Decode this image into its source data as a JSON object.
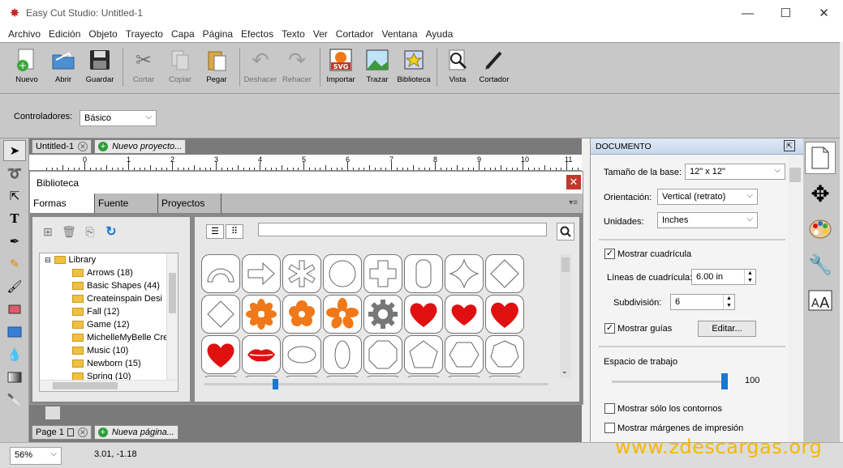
{
  "window": {
    "title": "Easy Cut Studio: Untitled-1"
  },
  "menu": [
    "Archivo",
    "Edición",
    "Objeto",
    "Trayecto",
    "Capa",
    "Página",
    "Efectos",
    "Texto",
    "Ver",
    "Cortador",
    "Ventana",
    "Ayuda"
  ],
  "toolbar": {
    "nuevo": "Nuevo",
    "abrir": "Abrir",
    "guardar": "Guardar",
    "cortar": "Cortar",
    "copiar": "Copiar",
    "pegar": "Pegar",
    "deshacer": "Deshacer",
    "rehacer": "Rehacer",
    "importar": "Importar",
    "trazar": "Trazar",
    "biblioteca": "Biblioteca",
    "vista": "Vista",
    "cortador": "Cortador"
  },
  "props": {
    "controladores_label": "Controladores:",
    "controladores_value": "Básico"
  },
  "doc_tabs": {
    "active": "Untitled-1",
    "new": "Nuevo proyecto..."
  },
  "ruler_numbers": [
    "0",
    "1",
    "2",
    "3",
    "4",
    "5",
    "6",
    "7",
    "8",
    "9",
    "10",
    "11"
  ],
  "library": {
    "title": "Biblioteca",
    "tabs": [
      "Formas",
      "Fuente",
      "Proyectos"
    ],
    "root": "Library",
    "items": [
      "Arrows (18)",
      "Basic Shapes (44)",
      "Createinspain Desi",
      "Fall (12)",
      "Game (12)",
      "MichelleMyBelle Cre",
      "Music (10)",
      "Newborn (15)",
      "Spring (10)"
    ]
  },
  "page_tabs": {
    "active": "Page 1",
    "new": "Nueva página..."
  },
  "document_panel": {
    "header": "DOCUMENTO",
    "tamano_label": "Tamaño de la base:",
    "tamano_value": "12\" x 12\"",
    "orientacion_label": "Orientación:",
    "orientacion_value": "Vertical (retrato)",
    "unidades_label": "Unidades:",
    "unidades_value": "Inches",
    "mostrar_cuadricula": "Mostrar cuadrícula",
    "lineas_label": "Líneas de cuadrícula:",
    "lineas_value": "6.00 in",
    "subdivision_label": "Subdivisión:",
    "subdivision_value": "6",
    "mostrar_guias": "Mostrar guías",
    "editar": "Editar...",
    "espacio_label": "Espacio de trabajo",
    "espacio_value": "100",
    "solo_contornos": "Mostrar sólo los contornos",
    "margenes": "Mostrar márgenes de impresión"
  },
  "status": {
    "zoom": "56%",
    "coords": "3.01, -1.18"
  },
  "watermark": "www.zdescargas.org",
  "colors": {
    "toolbar_bg": "#c8c8c8",
    "orange_flower": "#f07818",
    "red_heart": "#e01010",
    "blue_accent": "#1976d2"
  }
}
